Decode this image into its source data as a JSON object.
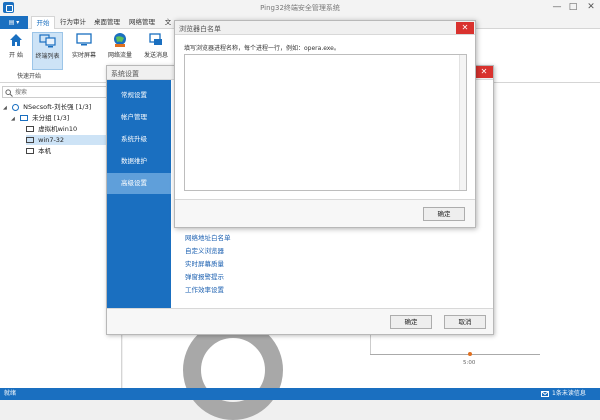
{
  "app": {
    "title": "Ping32终端安全管理系统"
  },
  "window_controls": {
    "minimize": "—",
    "maximize": "□",
    "close": "✕"
  },
  "ribbon_tabs": [
    {
      "label": "开始",
      "active": true
    },
    {
      "label": "行为审计",
      "active": false
    },
    {
      "label": "桌面管理",
      "active": false
    },
    {
      "label": "网络管理",
      "active": false
    },
    {
      "label": "文",
      "active": false
    }
  ],
  "file_button": {
    "label": "▤ ▾"
  },
  "ribbon": {
    "buttons": [
      {
        "label": "开 始",
        "icon": "home-icon"
      },
      {
        "label": "终端列表",
        "icon": "terminal-list-icon",
        "active": true
      },
      {
        "label": "实时屏幕",
        "icon": "monitor-icon"
      },
      {
        "label": "网络流量",
        "icon": "network-traffic-icon"
      },
      {
        "label": "发送消息",
        "icon": "send-message-icon"
      }
    ],
    "group_label": "快速开始"
  },
  "left_panel": {
    "search_placeholder": "搜索",
    "tree": [
      {
        "label": "NSecsoft-刘长强 [1/3]",
        "level": 0,
        "expand": "◢"
      },
      {
        "label": "未分组 [1/3]",
        "level": 1,
        "expand": "◢"
      },
      {
        "label": "虚拟机win10",
        "level": 2
      },
      {
        "label": "win7-32",
        "level": 2,
        "selected": true
      },
      {
        "label": "本机",
        "level": 2
      }
    ]
  },
  "main": {
    "tick_label": "5:00"
  },
  "settings_dialog": {
    "title": "系统设置",
    "nav": [
      "常规设置",
      "帐户管理",
      "系统升级",
      "数据维护",
      "高级设置"
    ],
    "active_nav": 4,
    "links": [
      "网络地址白名单",
      "自定义浏览器",
      "实时屏幕质量",
      "弹窗报警提示",
      "工作效率设置"
    ],
    "ok_label": "确定",
    "cancel_label": "取消"
  },
  "whitelist_dialog": {
    "title": "浏览器白名单",
    "hint": "填写浏览器进程名称，每个进程一行，例如：opera.exe。",
    "value": "",
    "ok_label": "确定"
  },
  "statusbar": {
    "left": "就绪",
    "right": "1条未读信息"
  },
  "colors": {
    "accent": "#1a6fc0",
    "nav_active": "#5f9fda",
    "close_red": "#d9322e",
    "link": "#1a5fb0"
  }
}
